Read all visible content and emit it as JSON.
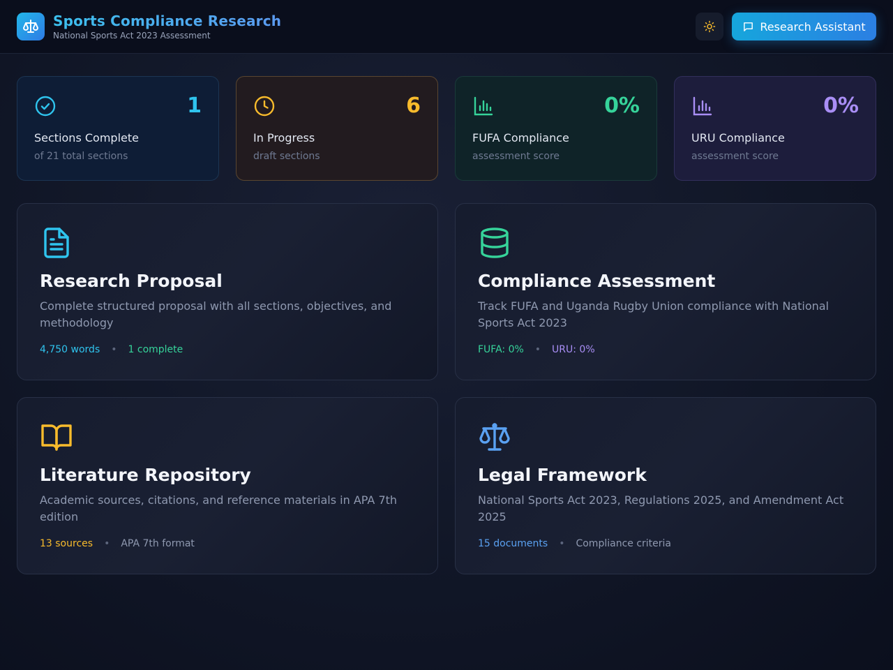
{
  "header": {
    "title": "Sports Compliance Research",
    "subtitle": "National Sports Act 2023 Assessment",
    "assistant_label": "Research Assistant"
  },
  "stats": [
    {
      "value": "1",
      "label": "Sections Complete",
      "sub": "of 21 total sections",
      "icon": "check-circle-icon",
      "color": "#2fc4ee"
    },
    {
      "value": "6",
      "label": "In Progress",
      "sub": "draft sections",
      "icon": "clock-icon",
      "color": "#f8bb2c"
    },
    {
      "value": "0%",
      "label": "FUFA Compliance",
      "sub": "assessment score",
      "icon": "bar-chart-icon",
      "color": "#36d39a"
    },
    {
      "value": "0%",
      "label": "URU Compliance",
      "sub": "assessment score",
      "icon": "bar-chart-icon",
      "color": "#a98ef5"
    }
  ],
  "cards": [
    {
      "title": "Research Proposal",
      "description": "Complete structured proposal with all sections, objectives, and methodology",
      "meta": [
        "4,750 words",
        "1 complete"
      ],
      "icon": "document-icon"
    },
    {
      "title": "Compliance Assessment",
      "description": "Track FUFA and Uganda Rugby Union compliance with National Sports Act 2023",
      "meta": [
        "FUFA: 0%",
        "URU: 0%"
      ],
      "icon": "database-icon"
    },
    {
      "title": "Literature Repository",
      "description": "Academic sources, citations, and reference materials in APA 7th edition",
      "meta": [
        "13 sources",
        "APA 7th format"
      ],
      "icon": "book-icon"
    },
    {
      "title": "Legal Framework",
      "description": "National Sports Act 2023, Regulations 2025, and Amendment Act 2025",
      "meta": [
        "15 documents",
        "Compliance criteria"
      ],
      "icon": "scale-icon"
    }
  ]
}
